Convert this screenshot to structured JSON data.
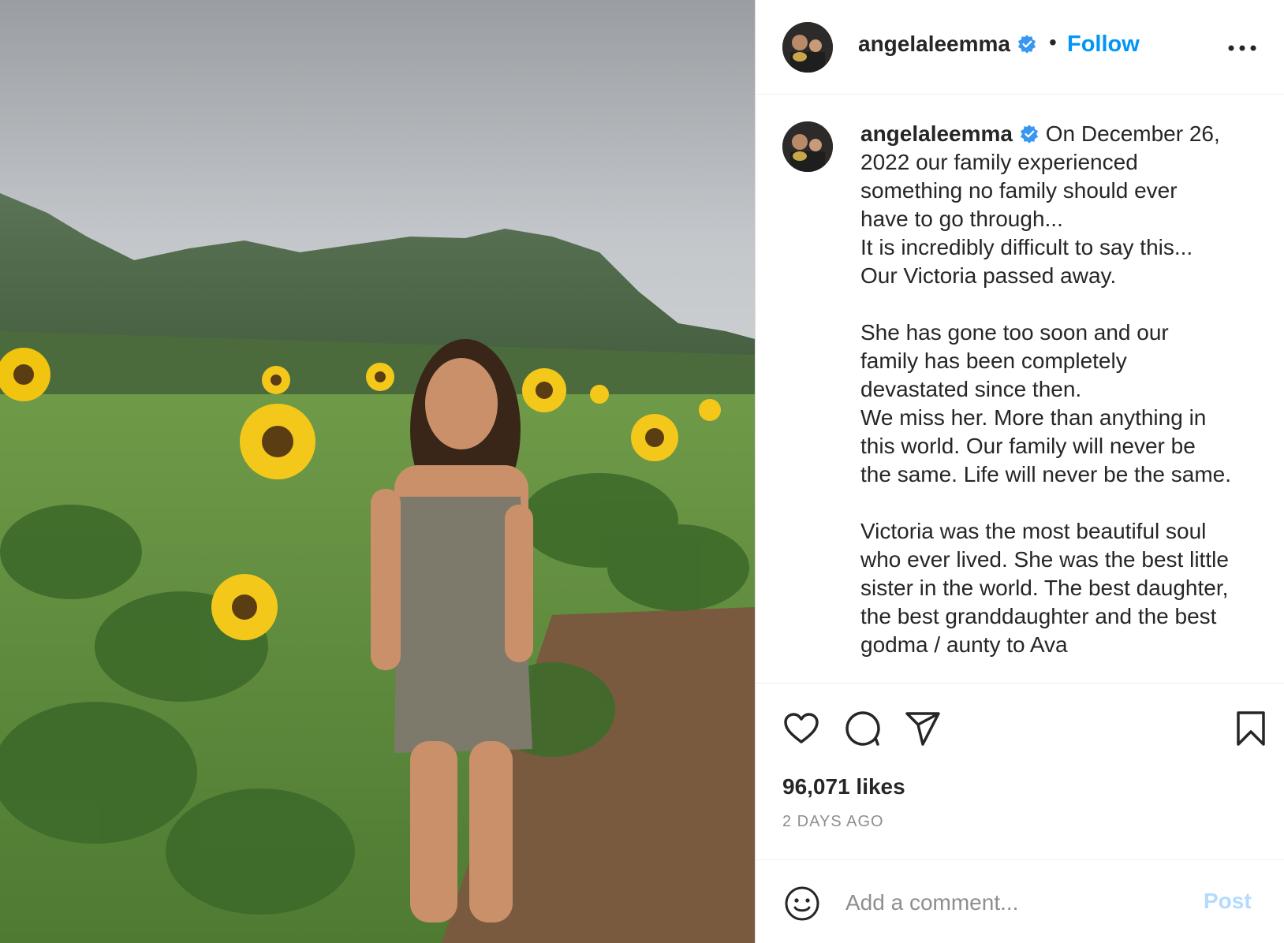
{
  "post": {
    "username": "angelaleemma",
    "follow_label": "Follow",
    "separator": "•",
    "caption": "On December 26, 2022 our family experienced something no family should ever have to go through...\nIt is incredibly difficult to say this...\nOur Victoria passed away.\n\nShe has gone too soon and our family has been completely devastated since then.\nWe miss her. More than anything in this world. Our family will never be the same. Life will never be the same.\n\nVictoria was the most beautiful soul who ever lived. She was the best little sister in the world. The best daughter, the best granddaughter and the best godma / aunty to Ava",
    "likes": "96,071 likes",
    "time_ago": "2 DAYS AGO"
  },
  "comment": {
    "placeholder": "Add a comment...",
    "post_label": "Post"
  },
  "colors": {
    "accent": "#0095f6",
    "post_disabled": "#b3dbff",
    "verified": "#3897f0",
    "text": "#262626",
    "muted": "#8e8e8e"
  },
  "icons": {
    "more": "more-horizontal-icon",
    "like": "heart-icon",
    "comment": "comment-bubble-icon",
    "share": "paper-plane-icon",
    "save": "bookmark-icon",
    "emoji": "smiley-icon",
    "verified": "verified-badge-icon"
  }
}
